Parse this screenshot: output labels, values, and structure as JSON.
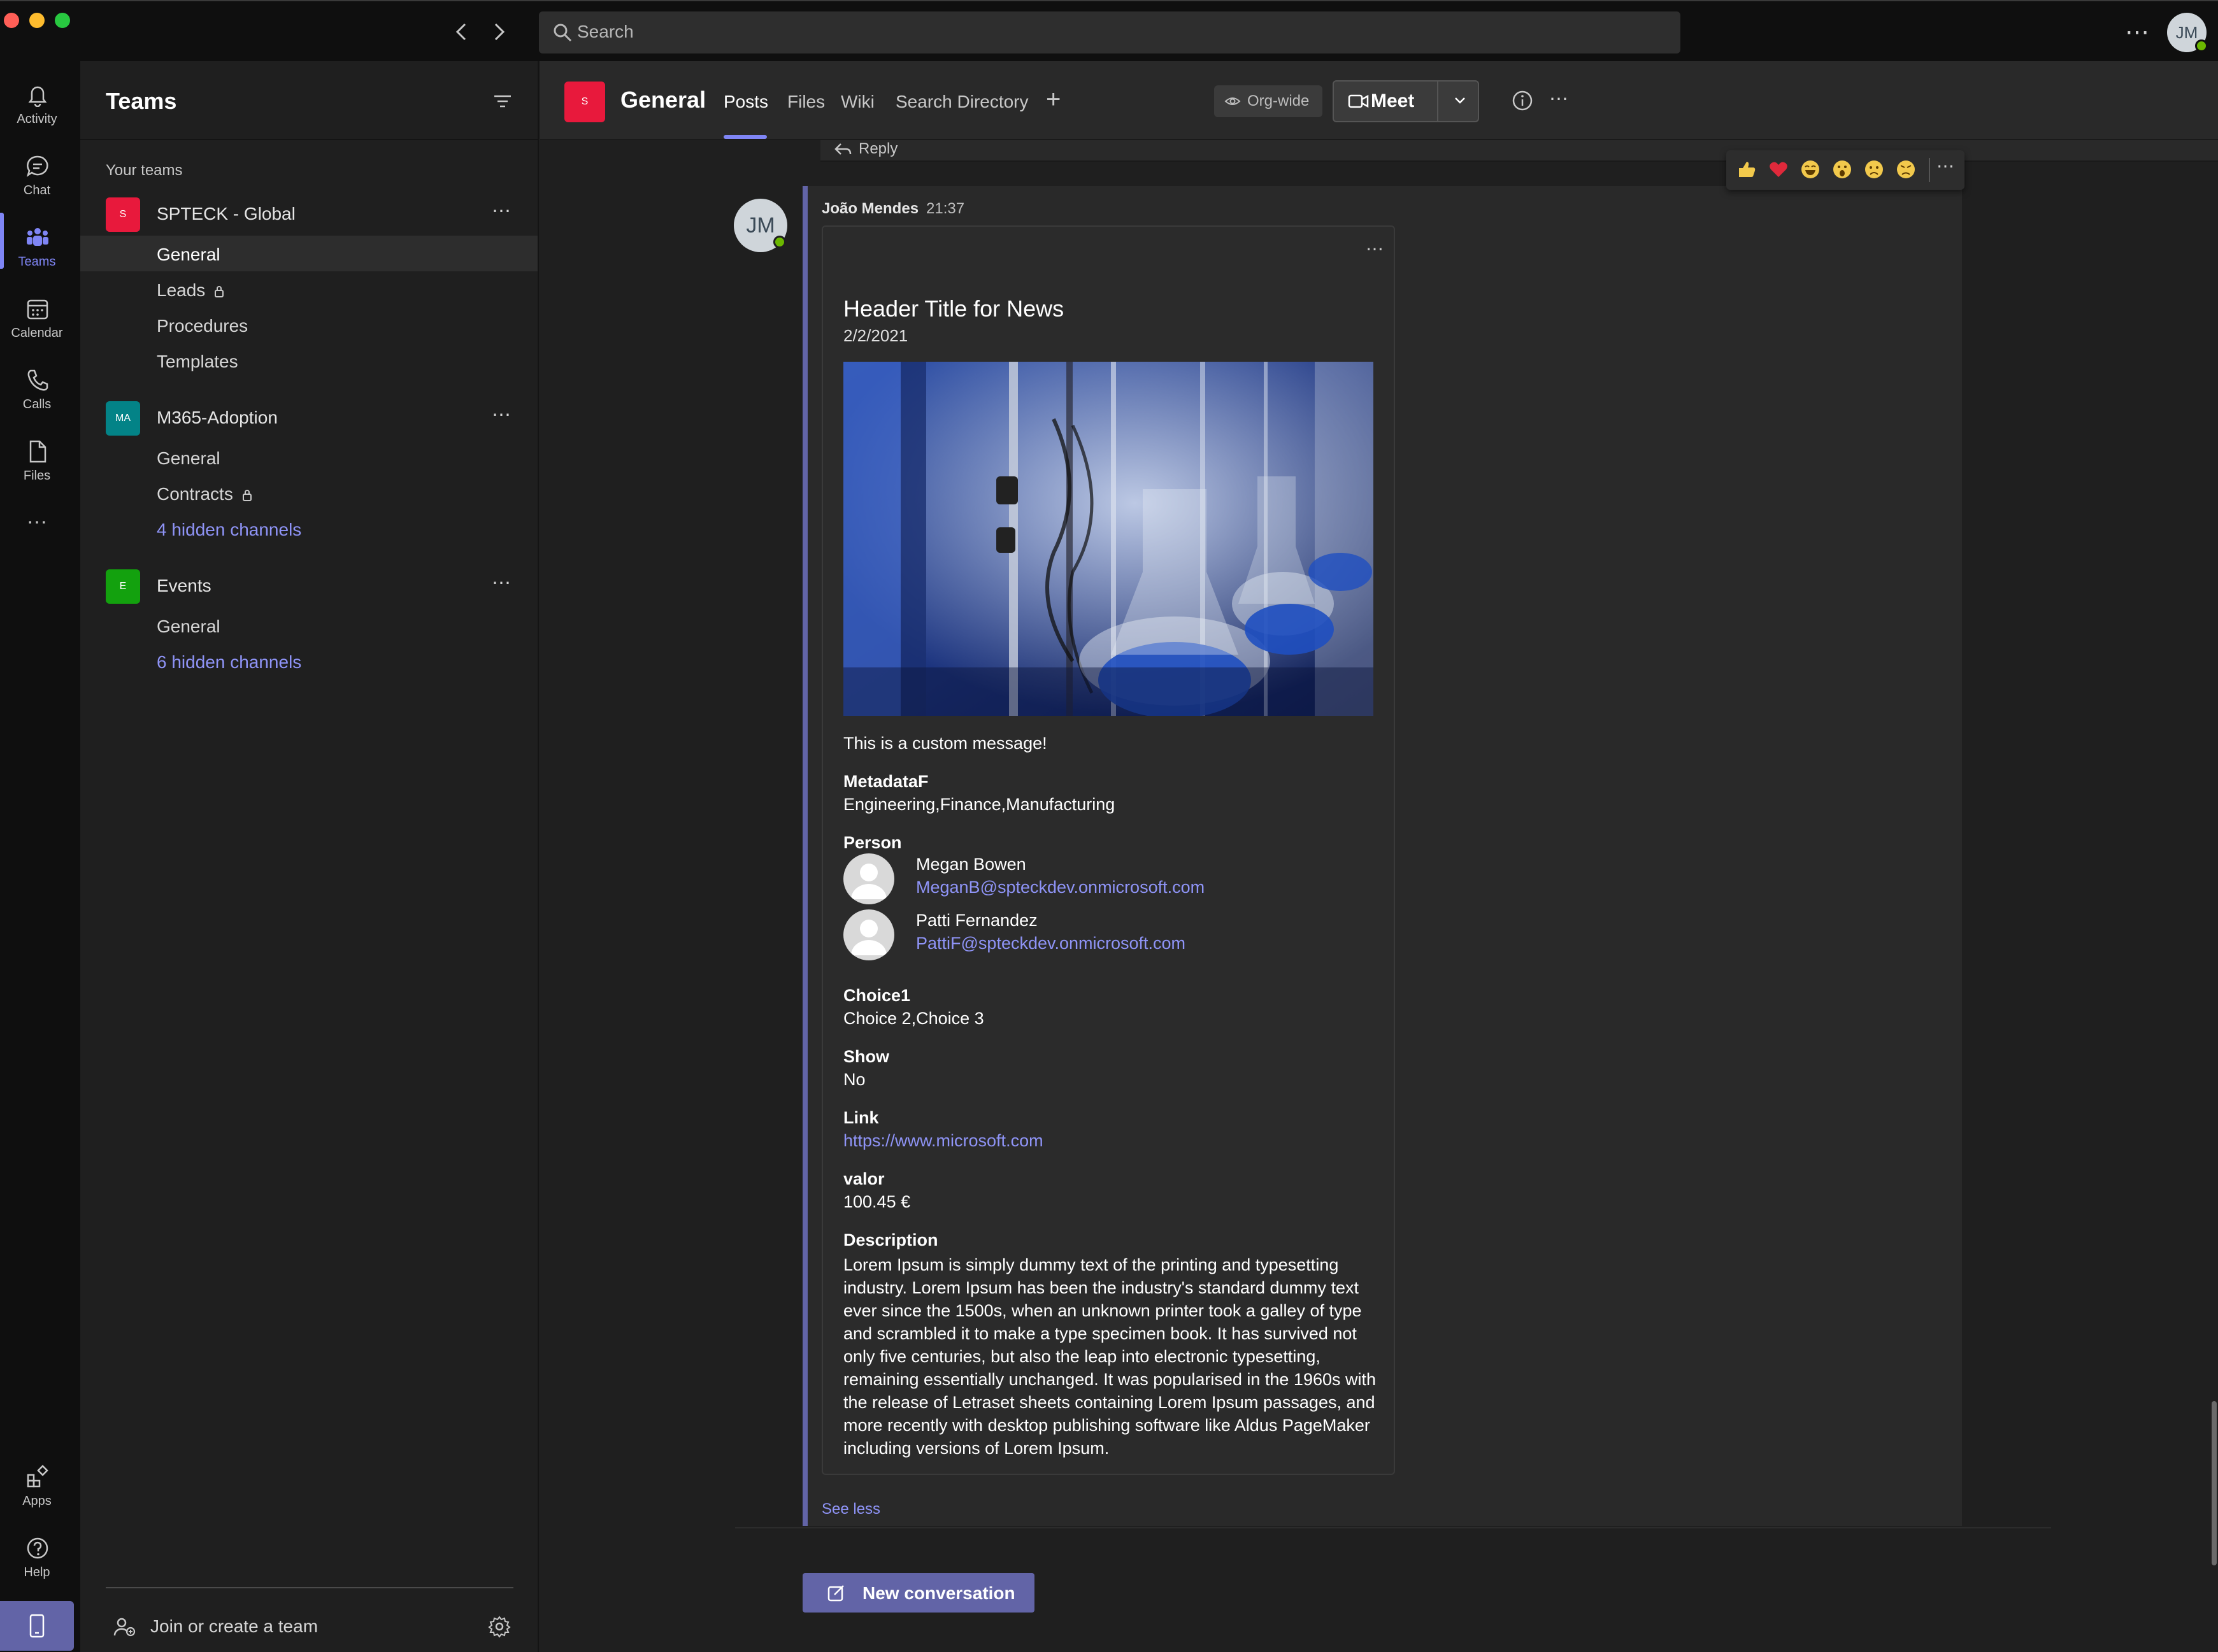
{
  "colors": {
    "accent": "#6264a7",
    "accent_light": "#7f85f5",
    "link": "#8f94f7",
    "presence": "#6bb700",
    "spteck_logo": "#e8193c",
    "m365_logo": "#038387",
    "events_logo": "#13a10e"
  },
  "titlebar": {
    "search_placeholder": "Search",
    "avatar_initials": "JM"
  },
  "rail": {
    "items": [
      {
        "label": "Activity",
        "icon": "bell-icon"
      },
      {
        "label": "Chat",
        "icon": "chat-icon"
      },
      {
        "label": "Teams",
        "icon": "teams-icon"
      },
      {
        "label": "Calendar",
        "icon": "calendar-icon"
      },
      {
        "label": "Calls",
        "icon": "phone-icon"
      },
      {
        "label": "Files",
        "icon": "file-icon"
      }
    ],
    "more": "…",
    "apps": "Apps",
    "help": "Help"
  },
  "sidebar": {
    "title": "Teams",
    "section_label": "Your teams",
    "teams": [
      {
        "name": "SPTECK - Global",
        "logo": "S",
        "channels": [
          "General",
          "Leads",
          "Procedures",
          "Templates"
        ]
      },
      {
        "name": "M365-Adoption",
        "logo": "MA",
        "channels": [
          "General",
          "Contracts",
          "4 hidden channels"
        ]
      },
      {
        "name": "Events",
        "logo": "E",
        "channels": [
          "General",
          "6 hidden channels"
        ]
      }
    ],
    "join_label": "Join or create a team"
  },
  "header": {
    "logo": "S",
    "channel_title": "General",
    "tabs": [
      "Posts",
      "Files",
      "Wiki",
      "Search Directory"
    ],
    "org_wide": "Org-wide",
    "meet": "Meet"
  },
  "thread": {
    "reply": "Reply",
    "author": "João Mendes",
    "time": "21:37",
    "avatar_initials": "JM",
    "card": {
      "title": "Header Title for News",
      "date": "2/2/2021",
      "message": "This is a custom message!",
      "metadata_label": "MetadataF",
      "metadata_value": "Engineering,Finance,Manufacturing",
      "person_label": "Person",
      "persons": [
        {
          "name": "Megan Bowen",
          "email": "MeganB@spteckdev.onmicrosoft.com"
        },
        {
          "name": "Patti Fernandez",
          "email": "PattiF@spteckdev.onmicrosoft.com"
        }
      ],
      "choice_label": "Choice1",
      "choice_value": "Choice 2,Choice 3",
      "show_label": "Show",
      "show_value": "No",
      "link_label": "Link",
      "link_value": "https://www.microsoft.com",
      "valor_label": "valor",
      "valor_value": "100.45 €",
      "description_label": "Description",
      "description": "Lorem Ipsum is simply dummy text of the printing and typesetting industry. Lorem Ipsum has been the industry's standard dummy text ever since the 1500s, when an unknown printer took a galley of type and scrambled it to make a type specimen book. It has survived not only five centuries, but also the leap into electronic typesetting, remaining essentially unchanged. It was popularised in the 1960s with the release of Letraset sheets containing Lorem Ipsum passages, and more recently with desktop publishing software like Aldus PageMaker including versions of Lorem Ipsum."
    },
    "see_less": "See less"
  },
  "compose": {
    "new_conversation": "New conversation"
  }
}
